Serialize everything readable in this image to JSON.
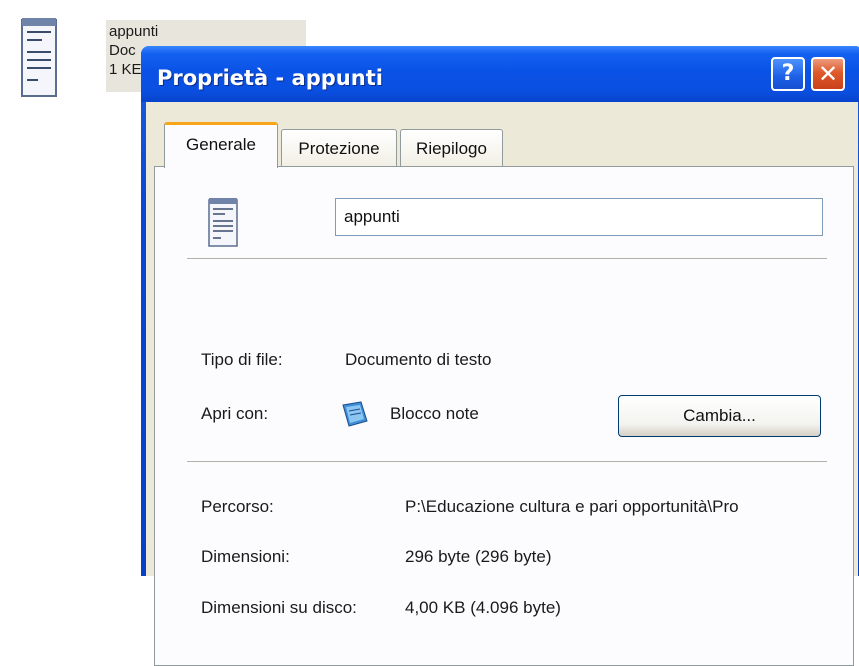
{
  "desktop": {
    "file_name": "appunti",
    "file_type_truncated": "Doc",
    "file_size_truncated": "1 KE",
    "icon": "notepad-document-icon"
  },
  "window": {
    "title": "Proprietà - appunti",
    "help_label": "?",
    "close_label": "✕",
    "tabs": [
      {
        "label": "Generale",
        "active": true
      },
      {
        "label": "Protezione",
        "active": false
      },
      {
        "label": "Riepilogo",
        "active": false
      }
    ]
  },
  "general": {
    "file_icon": "text-document-icon",
    "name_value": "appunti",
    "type_label": "Tipo di file:",
    "type_value": "Documento di testo",
    "open_with_label": "Apri con:",
    "open_with_app_icon": "notepad-app-icon",
    "open_with_value": "Blocco note",
    "change_button": "Cambia...",
    "path_label": "Percorso:",
    "path_value": "P:\\Educazione cultura e pari opportunità\\Pro",
    "size_label": "Dimensioni:",
    "size_value": "296 byte (296 byte)",
    "disk_size_label": "Dimensioni su disco:",
    "disk_size_value": "4,00 KB (4.096 byte)"
  },
  "colors": {
    "titlebar_blue": "#0a52e6",
    "close_red": "#df5a2a",
    "active_tab_accent": "#f7a61c",
    "dialog_face": "#ece9d8"
  }
}
